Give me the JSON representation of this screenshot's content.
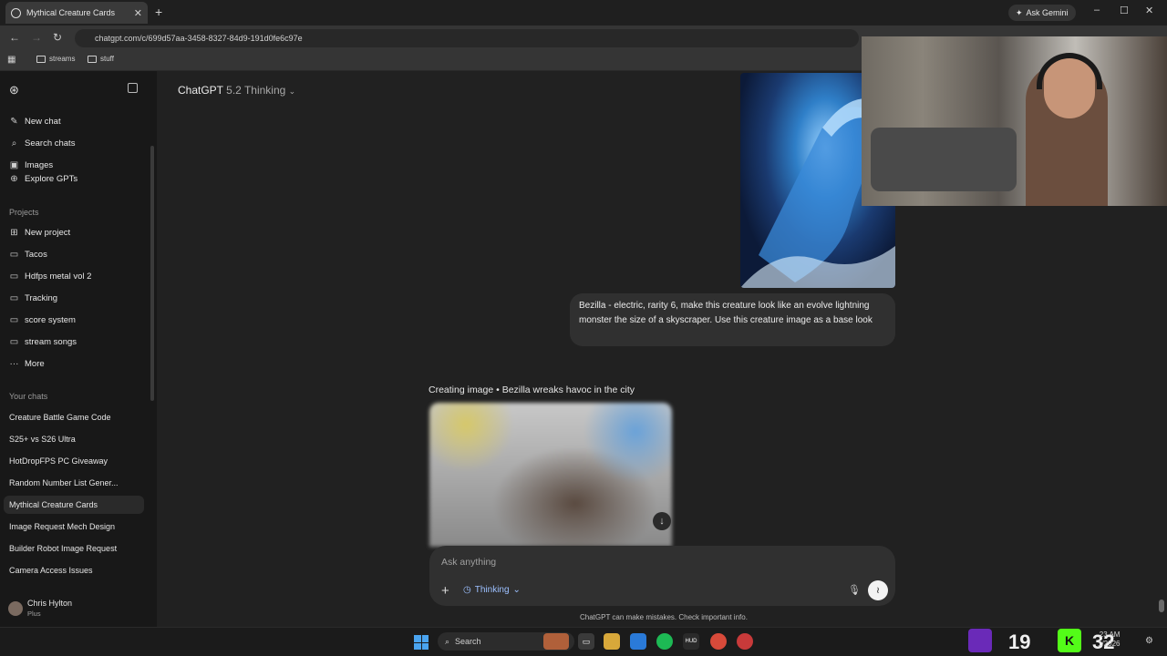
{
  "browser": {
    "tab_title": "Mythical Creature Cards",
    "new_tab": "+",
    "close": "✕",
    "gemini_label": "Ask Gemini",
    "url": "chatgpt.com/c/699d57aa-3458-8327-84d9-191d0fe6c97e",
    "bookmarks": [
      "streams",
      "stuff"
    ],
    "window_controls": [
      "–",
      "☐",
      "✕"
    ]
  },
  "sidebar": {
    "top_items": [
      {
        "icon": "edit-icon",
        "label": "New chat"
      },
      {
        "icon": "search-icon",
        "label": "Search chats"
      },
      {
        "icon": "image-icon",
        "label": "Images"
      },
      {
        "icon": "explore-icon",
        "label": "Explore GPTs"
      }
    ],
    "projects_heading": "Projects",
    "projects": [
      "New project",
      "Tacos",
      "Hdfps metal vol 2",
      "Tracking",
      "score system",
      "stream songs",
      "More"
    ],
    "chats_heading": "Your chats",
    "chats": [
      "Creature Battle Game Code",
      "S25+ vs S26 Ultra",
      "HotDropFPS PC Giveaway",
      "Random Number List Gener...",
      "Mythical Creature Cards",
      "Image Request Mech Design",
      "Builder Robot Image Request",
      "Camera Access Issues"
    ],
    "active_chat": "Mythical Creature Cards",
    "user": {
      "name": "Chris Hylton",
      "plan": "Plus"
    }
  },
  "main": {
    "model_name": "ChatGPT",
    "model_version": "5.2 Thinking",
    "user_message": "Bezilla - electric, rarity 6, make this creature look like an evolve lightning monster the size of a skyscraper. Use this creature image as a base look",
    "status": "Creating image • Bezilla wreaks havoc in the city",
    "composer_placeholder": "Ask anything",
    "mode_label": "Thinking",
    "disclaimer": "ChatGPT can make mistakes. Check important info."
  },
  "taskbar": {
    "search_label": "Search",
    "stat1": "19",
    "stat2": "32",
    "time": "23 AM",
    "date": "1/2026"
  }
}
